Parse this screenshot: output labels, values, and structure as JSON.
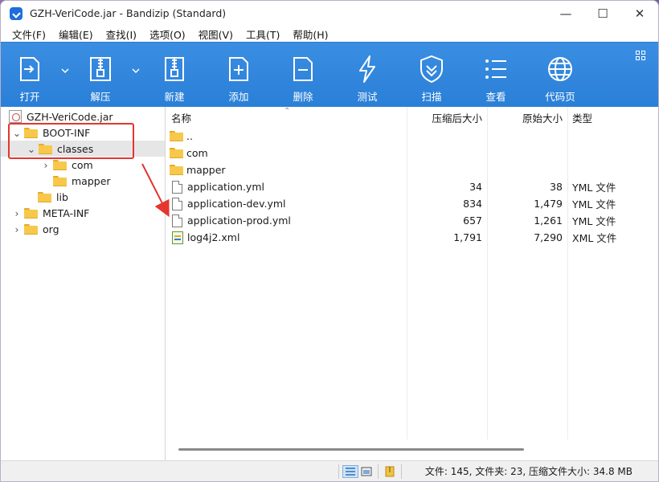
{
  "window": {
    "title": "GZH-VeriCode.jar - Bandizip (Standard)",
    "controls": {
      "minimize": "—",
      "maximize": "☐",
      "close": "✕"
    }
  },
  "menu": [
    "文件(F)",
    "编辑(E)",
    "查找(I)",
    "选项(O)",
    "视图(V)",
    "工具(T)",
    "帮助(H)"
  ],
  "toolbar": {
    "open": "打开",
    "extract": "解压",
    "new": "新建",
    "add": "添加",
    "delete": "删除",
    "test": "测试",
    "scan": "扫描",
    "view": "查看",
    "codepage": "代码页"
  },
  "tree": {
    "root": "GZH-VeriCode.jar",
    "items": [
      {
        "label": "BOOT-INF",
        "expanded": true,
        "depth": 0
      },
      {
        "label": "classes",
        "expanded": true,
        "depth": 1,
        "selected": true
      },
      {
        "label": "com",
        "expanded": false,
        "depth": 2
      },
      {
        "label": "mapper",
        "depth": 2
      },
      {
        "label": "lib",
        "depth": 1
      },
      {
        "label": "META-INF",
        "expanded": false,
        "depth": 0
      },
      {
        "label": "org",
        "expanded": false,
        "depth": 0
      }
    ]
  },
  "columns": {
    "name": "名称",
    "compressed": "压缩后大小",
    "original": "原始大小",
    "type": "类型"
  },
  "files": [
    {
      "name": "..",
      "kind": "folder",
      "compressed": "",
      "original": "",
      "type": ""
    },
    {
      "name": "com",
      "kind": "folder",
      "compressed": "",
      "original": "",
      "type": ""
    },
    {
      "name": "mapper",
      "kind": "folder",
      "compressed": "",
      "original": "",
      "type": ""
    },
    {
      "name": "application.yml",
      "kind": "doc",
      "compressed": "34",
      "original": "38",
      "type": "YML 文件"
    },
    {
      "name": "application-dev.yml",
      "kind": "doc",
      "compressed": "834",
      "original": "1,479",
      "type": "YML 文件"
    },
    {
      "name": "application-prod.yml",
      "kind": "doc",
      "compressed": "657",
      "original": "1,261",
      "type": "YML 文件"
    },
    {
      "name": "log4j2.xml",
      "kind": "xml",
      "compressed": "1,791",
      "original": "7,290",
      "type": "XML 文件"
    }
  ],
  "status": {
    "text": "文件: 145, 文件夹: 23, 压缩文件大小: 34.8 MB"
  },
  "colors": {
    "toolbar": "#2a7fd7",
    "highlight": "#e4362f",
    "folder": "#f7c84a"
  }
}
